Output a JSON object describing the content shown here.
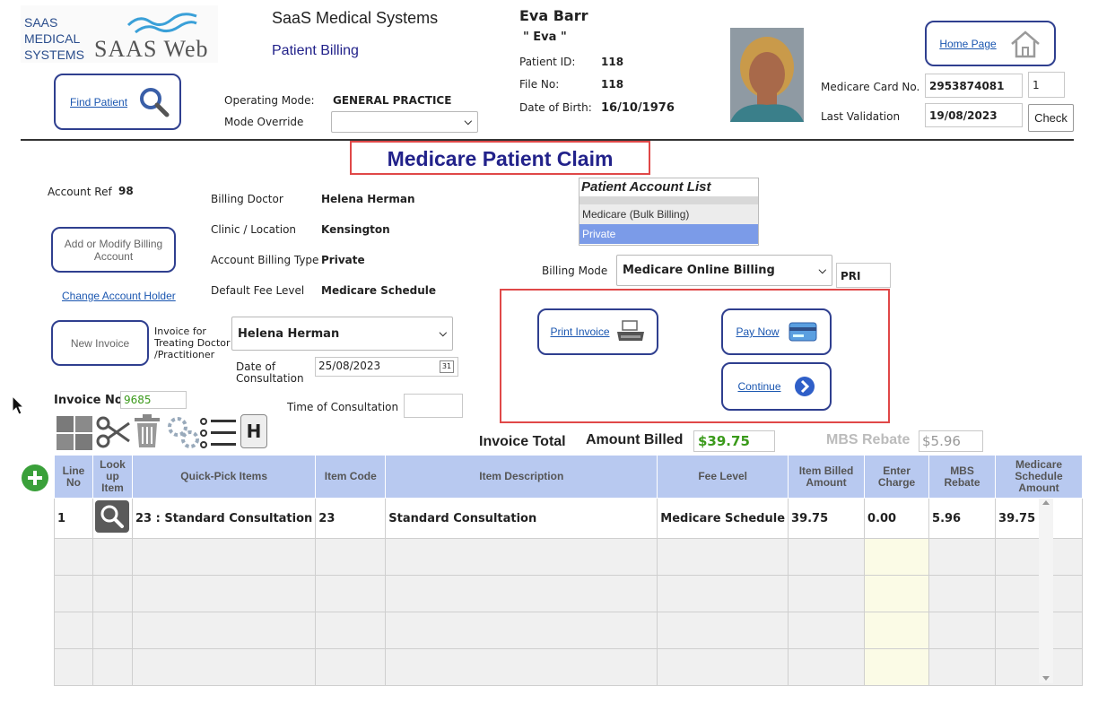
{
  "logo": {
    "line1": "SAAS",
    "line2": "MEDICAL",
    "line3": "SYSTEMS",
    "web": "SAAS Web"
  },
  "header": {
    "company": "SaaS Medical Systems",
    "module": "Patient Billing"
  },
  "patient": {
    "name": "Eva Barr",
    "nickname": "\" Eva \"",
    "id_label": "Patient ID:",
    "id_value": "118",
    "file_label": "File No:",
    "file_value": "118",
    "dob_label": "Date of Birth:",
    "dob_value": "16/10/1976"
  },
  "medicare": {
    "card_label": "Medicare Card No.",
    "card_value": "2953874081",
    "card_irn": "1",
    "validation_label": "Last Validation",
    "validation_value": "19/08/2023",
    "check_label": "Check"
  },
  "nav": {
    "home": "Home Page",
    "find_patient": "Find Patient"
  },
  "mode": {
    "operating_label": "Operating Mode:",
    "operating_value": "GENERAL PRACTICE",
    "override_label": "Mode Override",
    "override_value": ""
  },
  "claim_title": "Medicare Patient Claim",
  "account": {
    "ref_label": "Account Ref",
    "ref_value": "98",
    "add_modify_label": "Add or Modify Billing Account",
    "change_holder_label": "Change Account Holder",
    "billing_doctor_label": "Billing Doctor",
    "billing_doctor_value": "Helena Herman",
    "clinic_label": "Clinic / Location",
    "clinic_value": "Kensington",
    "billing_type_label": "Account Billing Type",
    "billing_type_value": "Private",
    "fee_level_label": "Default Fee Level",
    "fee_level_value": "Medicare Schedule"
  },
  "account_list": {
    "title": "Patient Account List",
    "items": [
      "Medicare (Bulk Billing)",
      "Private"
    ]
  },
  "billing_mode": {
    "label": "Billing Mode",
    "value": "Medicare Online Billing",
    "code": "PRI"
  },
  "invoice": {
    "new_label": "New Invoice",
    "for_label": "Invoice for Treating Doctor /Practitioner",
    "doctor_value": "Helena Herman",
    "date_label": "Date of Consultation",
    "date_value": "25/08/2023",
    "time_label": "Time of Consultation",
    "time_value": "",
    "number_label": "Invoice No.",
    "number_value": "9685",
    "total_label": "Invoice Total",
    "amount_billed_label": "Amount Billed",
    "amount_billed_value": "$39.75",
    "mbs_rebate_label": "MBS Rebate",
    "mbs_rebate_value": "$5.96"
  },
  "actions": {
    "print_invoice": "Print Invoice",
    "pay_now": "Pay Now",
    "continue": "Continue"
  },
  "toolbar": {
    "history_letter": "H"
  },
  "table": {
    "headers": [
      "Line No",
      "Look up Item",
      "Quick-Pick Items",
      "Item Code",
      "Item Description",
      "Fee Level",
      "Item Billed Amount",
      "Enter Charge",
      "MBS Rebate",
      "Medicare Schedule Amount"
    ],
    "rows": [
      {
        "line": "1",
        "quick_pick": "23 : Standard Consultation",
        "code": "23",
        "description": "Standard Consultation",
        "fee_level": "Medicare Schedule",
        "billed": "39.75",
        "charge": "0.00",
        "rebate": "5.96",
        "schedule": "39.75"
      }
    ]
  },
  "colors": {
    "accent_navy": "#2f3f8f",
    "title_blue": "#22228a",
    "highlight_red": "#e04848",
    "amount_green": "#3a9a1a",
    "selected_blue": "#7b9be8",
    "header_blue": "#b8c9f0"
  }
}
